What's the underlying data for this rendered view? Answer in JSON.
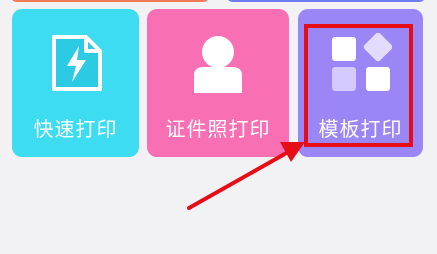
{
  "tiles": [
    {
      "id": "quick-print",
      "label": "快速打印",
      "icon": "lightning-document-icon",
      "color": "#3ddcf1"
    },
    {
      "id": "id-photo-print",
      "label": "证件照打印",
      "icon": "person-portrait-icon",
      "color": "#f96fb3"
    },
    {
      "id": "template-print",
      "label": "模板打印",
      "icon": "template-grid-icon",
      "color": "#9b86f6"
    }
  ],
  "annotation": {
    "highlight_color": "#e60d17"
  }
}
